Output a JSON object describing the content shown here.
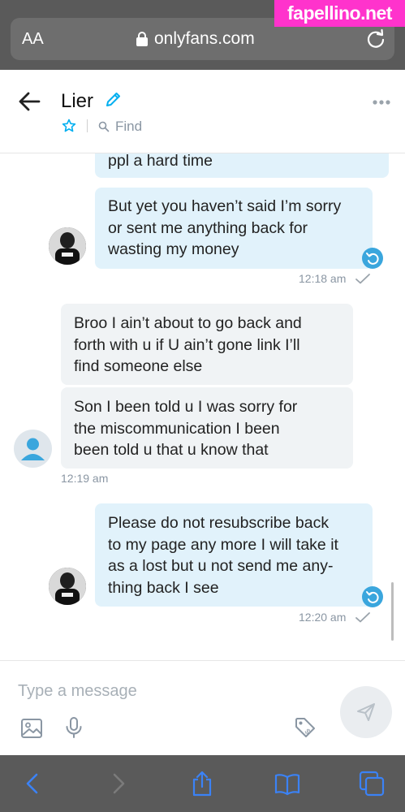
{
  "browser": {
    "aa_label": "AA",
    "url": "onlyfans.com",
    "nav": {
      "back": "back-arrow-icon",
      "forward": "forward-arrow-icon",
      "share": "share-icon",
      "bookmarks": "book-icon",
      "tabs": "tabs-icon"
    }
  },
  "watermark": "fapellino.net",
  "chat": {
    "title": "Lier",
    "find_label": "Find"
  },
  "messages": [
    {
      "id": "m1",
      "direction": "out",
      "text": "ppl a hard time"
    },
    {
      "id": "m2",
      "direction": "out",
      "text": "But yet you haven’t said I’m sorry\nor sent me anything back for\nwasting my money"
    },
    {
      "id": "t1",
      "time": "12:18 am"
    },
    {
      "id": "m3",
      "direction": "in",
      "text": "Broo I ain’t about to go back and\nforth with u if U ain’t gone link I’ll\nfind someone else"
    },
    {
      "id": "m4",
      "direction": "in",
      "text": "Son I been told u I was sorry for\nthe miscommunication I been\nbeen told u that u know that"
    },
    {
      "id": "t2",
      "time": "12:19 am"
    },
    {
      "id": "m5",
      "direction": "out",
      "text": "Please do not resubscribe back\nto my page any more I will take it\nas a lost but u not send me any-\nthing back I see"
    },
    {
      "id": "t3",
      "time": "12:20 am"
    }
  ],
  "composer": {
    "placeholder": "Type a message"
  },
  "colors": {
    "outgoing_bubble": "#e1f2fb",
    "incoming_bubble": "#f0f3f5",
    "accent": "#00aff0",
    "undo_badge": "#3aa6dd",
    "browser_chrome": "#5a5a5a",
    "safari_blue": "#3b82f6",
    "watermark_bg": "#ff33cc"
  }
}
